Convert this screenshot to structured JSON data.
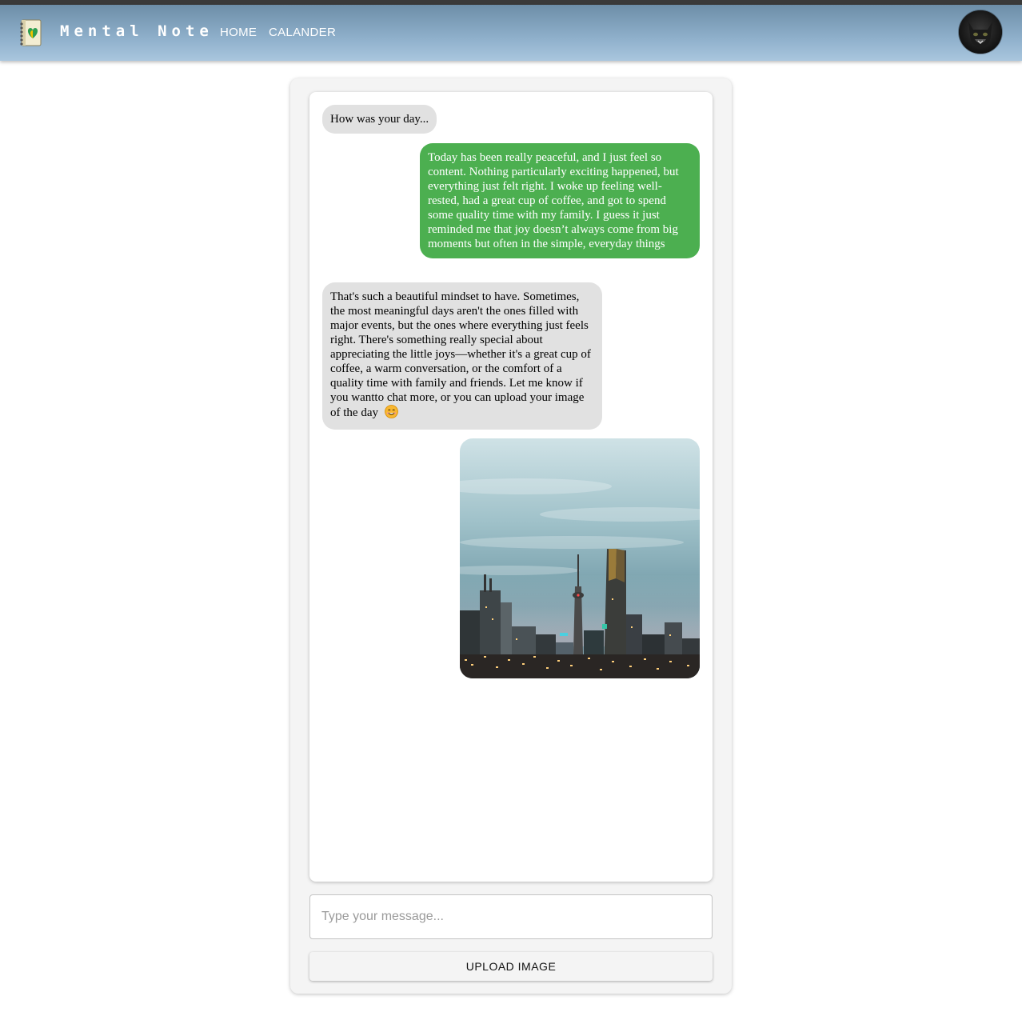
{
  "app": {
    "brand": "Mental Note",
    "nav": [
      {
        "label": "HOME"
      },
      {
        "label": "CALANDER"
      }
    ]
  },
  "chat": {
    "messages": [
      {
        "sender": "bot",
        "text": "How was your day..."
      },
      {
        "sender": "user",
        "text": "Today has been really peaceful, and I just feel so content. Nothing particularly exciting happened, but everything just felt right. I woke up feeling well-rested, had a great cup of coffee, and got to spend some quality time with my family. I guess it just reminded me that joy doesn’t always come from big moments but often in the simple, everyday things"
      },
      {
        "sender": "bot",
        "text": "That's such a beautiful mindset to have. Sometimes, the most meaningful days aren't the ones filled with major events, but the ones where everything just feels right. There's something really special about appreciating the little joys—whether it's a great cup of coffee, a warm conversation, or the comfort of a quality time with family and friends. Let me know if you wantto chat more, or you can upload your image of the day"
      },
      {
        "sender": "user",
        "type": "image"
      }
    ]
  },
  "composer": {
    "placeholder": "Type your message...",
    "upload_label": "UPLOAD IMAGE"
  },
  "colors": {
    "user_bubble": "#4caf50",
    "bot_bubble": "#e1e1e1",
    "appbar": "#8fb0cb"
  }
}
